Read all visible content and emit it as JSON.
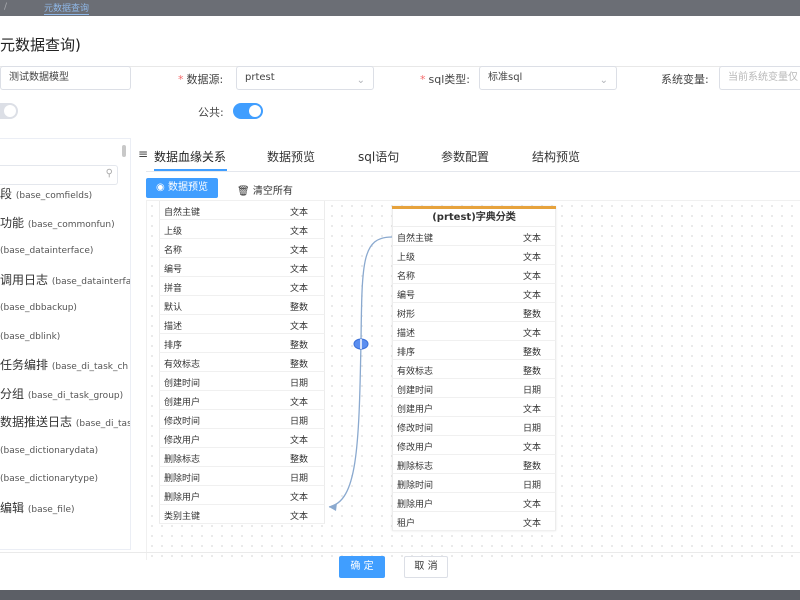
{
  "backdrop": {
    "breadcrumb_sep": "/",
    "breadcrumb_link": "元数据查询"
  },
  "dialog": {
    "title": "元数据查询)"
  },
  "form": {
    "name_value": "测试数据模型",
    "datasource": {
      "label": "数据源:",
      "value": "prtest"
    },
    "sql_type": {
      "label": "sql类型:",
      "value": "标准sql"
    },
    "sys_var": {
      "label": "系统变量:",
      "placeholder": "当前系统变量仅"
    },
    "public_label": "公共:",
    "toggle_left_on": false,
    "toggle_public_on": true
  },
  "left_list": [
    {
      "cn": "段",
      "tbl": "(base_comfields)"
    },
    {
      "cn": "功能",
      "tbl": "(base_commonfun)"
    },
    {
      "cn": "",
      "tbl": "(base_datainterface)"
    },
    {
      "cn": "调用日志",
      "tbl": "(base_datainterfa"
    },
    {
      "cn": "",
      "tbl": "(base_dbbackup)"
    },
    {
      "cn": "",
      "tbl": "(base_dblink)"
    },
    {
      "cn": "任务编排",
      "tbl": "(base_di_task_ch"
    },
    {
      "cn": "分组",
      "tbl": "(base_di_task_group)"
    },
    {
      "cn": "数据推送日志",
      "tbl": "(base_di_tas"
    },
    {
      "cn": "",
      "tbl": "(base_dictionarydata)"
    },
    {
      "cn": "",
      "tbl": "(base_dictionarytype)"
    },
    {
      "cn": "编辑",
      "tbl": "(base_file)"
    }
  ],
  "tabs": [
    "数据血缘关系",
    "数据预览",
    "sql语句",
    "参数配置",
    "结构预览"
  ],
  "toolbar": {
    "preview_label": "数据预览",
    "clear_label": "清空所有"
  },
  "source_table": {
    "rows": [
      {
        "name": "自然主键",
        "type": "文本"
      },
      {
        "name": "上级",
        "type": "文本"
      },
      {
        "name": "名称",
        "type": "文本"
      },
      {
        "name": "编号",
        "type": "文本"
      },
      {
        "name": "拼音",
        "type": "文本"
      },
      {
        "name": "默认",
        "type": "整数"
      },
      {
        "name": "描述",
        "type": "文本"
      },
      {
        "name": "排序",
        "type": "整数"
      },
      {
        "name": "有效标志",
        "type": "整数"
      },
      {
        "name": "创建时间",
        "type": "日期"
      },
      {
        "name": "创建用户",
        "type": "文本"
      },
      {
        "name": "修改时间",
        "type": "日期"
      },
      {
        "name": "修改用户",
        "type": "文本"
      },
      {
        "name": "删除标志",
        "type": "整数"
      },
      {
        "name": "删除时间",
        "type": "日期"
      },
      {
        "name": "删除用户",
        "type": "文本"
      },
      {
        "name": "类别主键",
        "type": "文本"
      }
    ]
  },
  "target_table": {
    "title": "(prtest)字典分类",
    "rows": [
      {
        "name": "自然主键",
        "type": "文本"
      },
      {
        "name": "上级",
        "type": "文本"
      },
      {
        "name": "名称",
        "type": "文本"
      },
      {
        "name": "编号",
        "type": "文本"
      },
      {
        "name": "树形",
        "type": "整数"
      },
      {
        "name": "描述",
        "type": "文本"
      },
      {
        "name": "排序",
        "type": "整数"
      },
      {
        "name": "有效标志",
        "type": "整数"
      },
      {
        "name": "创建时间",
        "type": "日期"
      },
      {
        "name": "创建用户",
        "type": "文本"
      },
      {
        "name": "修改时间",
        "type": "日期"
      },
      {
        "name": "修改用户",
        "type": "文本"
      },
      {
        "name": "删除标志",
        "type": "整数"
      },
      {
        "name": "删除时间",
        "type": "日期"
      },
      {
        "name": "删除用户",
        "type": "文本"
      },
      {
        "name": "租户",
        "type": "文本"
      }
    ]
  },
  "footer": {
    "ok_label": "确 定",
    "cancel_label": "取 消"
  },
  "colors": {
    "primary": "#409eff",
    "table_header_accent": "#e6a23c",
    "overlay": "#5c5f66"
  }
}
